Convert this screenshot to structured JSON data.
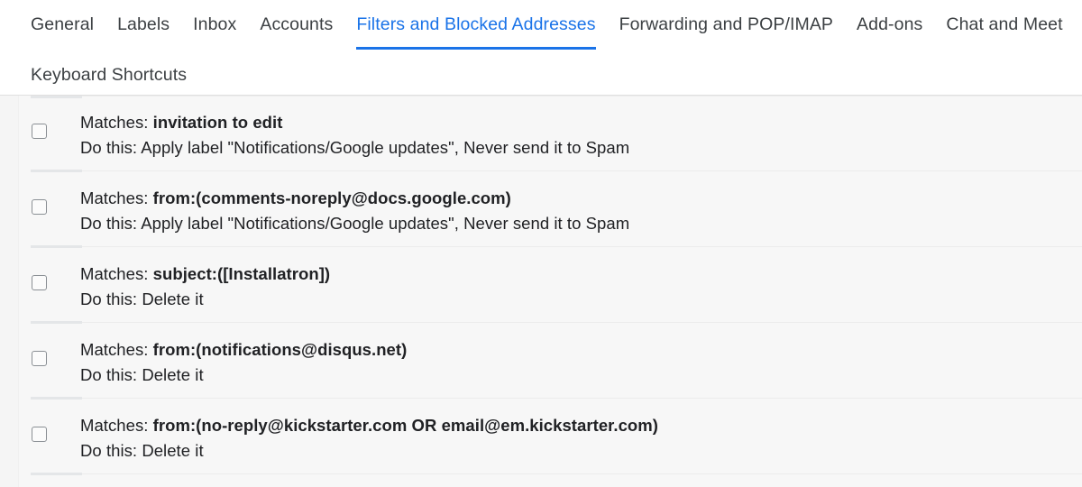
{
  "settings": {
    "tabs": [
      {
        "label": "General",
        "active": false
      },
      {
        "label": "Labels",
        "active": false
      },
      {
        "label": "Inbox",
        "active": false
      },
      {
        "label": "Accounts",
        "active": false
      },
      {
        "label": "Filters and Blocked Addresses",
        "active": true
      },
      {
        "label": "Forwarding and POP/IMAP",
        "active": false
      },
      {
        "label": "Add-ons",
        "active": false
      },
      {
        "label": "Chat and Meet",
        "active": false
      },
      {
        "label": "Keyboard Shortcuts",
        "active": false
      }
    ],
    "active_tab": "Filters and Blocked Addresses",
    "accent_color": "#1a73e8",
    "text_color": "#3c4043"
  },
  "filters": {
    "matches_label": "Matches:",
    "action_label": "Do this:",
    "checkbox_state": "unchecked",
    "rows": [
      {
        "criteria": "invitation to edit",
        "action": "Apply label \"Notifications/Google updates\", Never send it to Spam"
      },
      {
        "criteria": "from:(comments-noreply@docs.google.com)",
        "action": "Apply label \"Notifications/Google updates\", Never send it to Spam"
      },
      {
        "criteria": "subject:([Installatron])",
        "action": "Delete it"
      },
      {
        "criteria": "from:(notifications@disqus.net)",
        "action": "Delete it"
      },
      {
        "criteria": "from:(no-reply@kickstarter.com OR email@em.kickstarter.com)",
        "action": "Delete it"
      }
    ]
  }
}
